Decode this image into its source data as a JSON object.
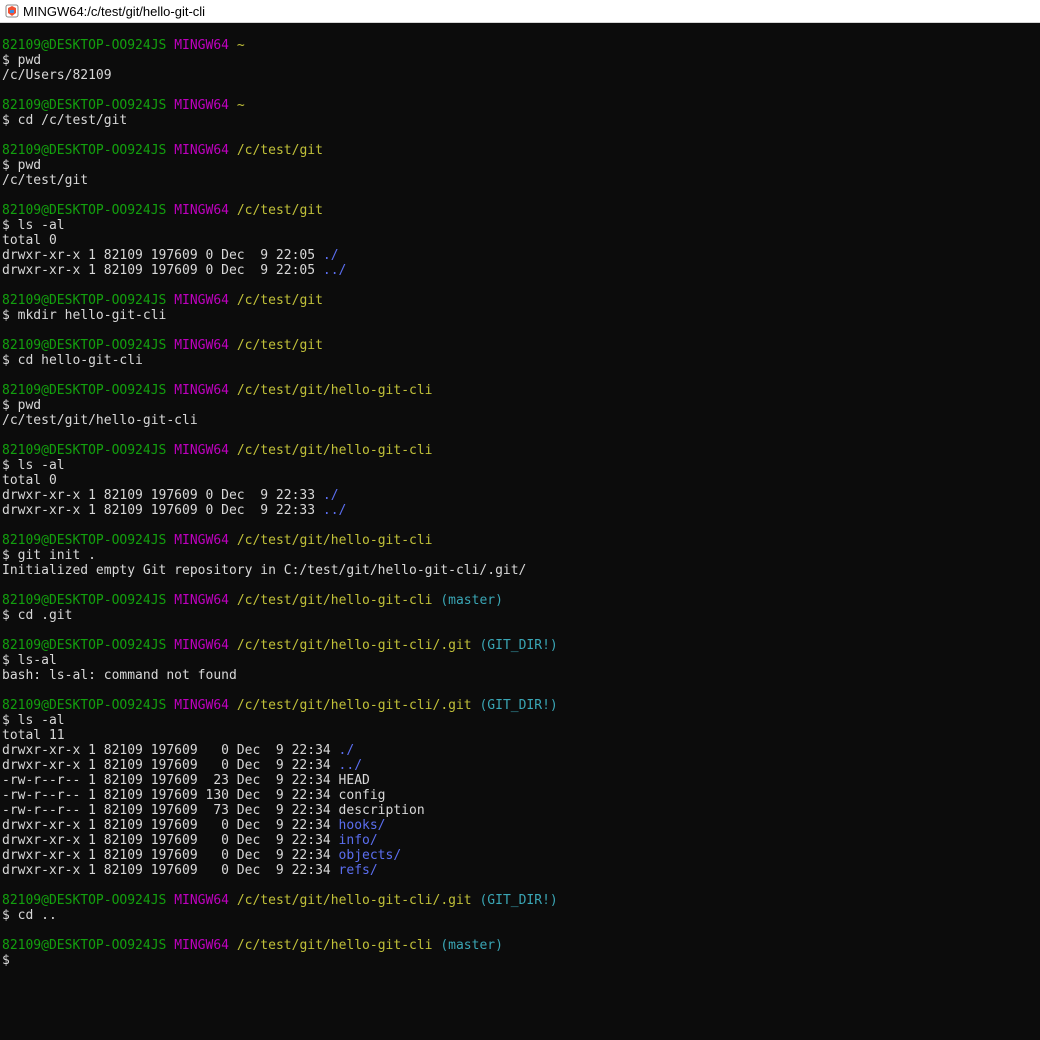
{
  "window": {
    "title": "MINGW64:/c/test/git/hello-git-cli",
    "icon": "git-bash-icon"
  },
  "colors": {
    "user": "#13a10e",
    "host": "#bf00bf",
    "path": "#c1c139",
    "branch": "#3aa6b5",
    "dir": "#5b6ef0",
    "text": "#d8d8d8",
    "background": "#0c0c0c"
  },
  "terminal": {
    "lines": [
      [
        {
          "t": "82109@DESKTOP-OO924JS",
          "c": "user"
        },
        {
          "t": " "
        },
        {
          "t": "MINGW64",
          "c": "host"
        },
        {
          "t": " "
        },
        {
          "t": "~",
          "c": "path"
        }
      ],
      [
        {
          "t": "$ pwd"
        }
      ],
      [
        {
          "t": "/c/Users/82109"
        }
      ],
      [],
      [
        {
          "t": "82109@DESKTOP-OO924JS",
          "c": "user"
        },
        {
          "t": " "
        },
        {
          "t": "MINGW64",
          "c": "host"
        },
        {
          "t": " "
        },
        {
          "t": "~",
          "c": "path"
        }
      ],
      [
        {
          "t": "$ cd /c/test/git"
        }
      ],
      [],
      [
        {
          "t": "82109@DESKTOP-OO924JS",
          "c": "user"
        },
        {
          "t": " "
        },
        {
          "t": "MINGW64",
          "c": "host"
        },
        {
          "t": " "
        },
        {
          "t": "/c/test/git",
          "c": "path"
        }
      ],
      [
        {
          "t": "$ pwd"
        }
      ],
      [
        {
          "t": "/c/test/git"
        }
      ],
      [],
      [
        {
          "t": "82109@DESKTOP-OO924JS",
          "c": "user"
        },
        {
          "t": " "
        },
        {
          "t": "MINGW64",
          "c": "host"
        },
        {
          "t": " "
        },
        {
          "t": "/c/test/git",
          "c": "path"
        }
      ],
      [
        {
          "t": "$ ls -al"
        }
      ],
      [
        {
          "t": "total 0"
        }
      ],
      [
        {
          "t": "drwxr-xr-x 1 82109 197609 0 Dec  9 22:05 "
        },
        {
          "t": "./",
          "c": "dir"
        }
      ],
      [
        {
          "t": "drwxr-xr-x 1 82109 197609 0 Dec  9 22:05 "
        },
        {
          "t": "../",
          "c": "dir"
        }
      ],
      [],
      [
        {
          "t": "82109@DESKTOP-OO924JS",
          "c": "user"
        },
        {
          "t": " "
        },
        {
          "t": "MINGW64",
          "c": "host"
        },
        {
          "t": " "
        },
        {
          "t": "/c/test/git",
          "c": "path"
        }
      ],
      [
        {
          "t": "$ mkdir hello-git-cli"
        }
      ],
      [],
      [
        {
          "t": "82109@DESKTOP-OO924JS",
          "c": "user"
        },
        {
          "t": " "
        },
        {
          "t": "MINGW64",
          "c": "host"
        },
        {
          "t": " "
        },
        {
          "t": "/c/test/git",
          "c": "path"
        }
      ],
      [
        {
          "t": "$ cd hello-git-cli"
        }
      ],
      [],
      [
        {
          "t": "82109@DESKTOP-OO924JS",
          "c": "user"
        },
        {
          "t": " "
        },
        {
          "t": "MINGW64",
          "c": "host"
        },
        {
          "t": " "
        },
        {
          "t": "/c/test/git/hello-git-cli",
          "c": "path"
        }
      ],
      [
        {
          "t": "$ pwd"
        }
      ],
      [
        {
          "t": "/c/test/git/hello-git-cli"
        }
      ],
      [],
      [
        {
          "t": "82109@DESKTOP-OO924JS",
          "c": "user"
        },
        {
          "t": " "
        },
        {
          "t": "MINGW64",
          "c": "host"
        },
        {
          "t": " "
        },
        {
          "t": "/c/test/git/hello-git-cli",
          "c": "path"
        }
      ],
      [
        {
          "t": "$ ls -al"
        }
      ],
      [
        {
          "t": "total 0"
        }
      ],
      [
        {
          "t": "drwxr-xr-x 1 82109 197609 0 Dec  9 22:33 "
        },
        {
          "t": "./",
          "c": "dir"
        }
      ],
      [
        {
          "t": "drwxr-xr-x 1 82109 197609 0 Dec  9 22:33 "
        },
        {
          "t": "../",
          "c": "dir"
        }
      ],
      [],
      [
        {
          "t": "82109@DESKTOP-OO924JS",
          "c": "user"
        },
        {
          "t": " "
        },
        {
          "t": "MINGW64",
          "c": "host"
        },
        {
          "t": " "
        },
        {
          "t": "/c/test/git/hello-git-cli",
          "c": "path"
        }
      ],
      [
        {
          "t": "$ git init ."
        }
      ],
      [
        {
          "t": "Initialized empty Git repository in C:/test/git/hello-git-cli/.git/"
        }
      ],
      [],
      [
        {
          "t": "82109@DESKTOP-OO924JS",
          "c": "user"
        },
        {
          "t": " "
        },
        {
          "t": "MINGW64",
          "c": "host"
        },
        {
          "t": " "
        },
        {
          "t": "/c/test/git/hello-git-cli",
          "c": "path"
        },
        {
          "t": " "
        },
        {
          "t": "(master)",
          "c": "branch"
        }
      ],
      [
        {
          "t": "$ cd .git"
        }
      ],
      [],
      [
        {
          "t": "82109@DESKTOP-OO924JS",
          "c": "user"
        },
        {
          "t": " "
        },
        {
          "t": "MINGW64",
          "c": "host"
        },
        {
          "t": " "
        },
        {
          "t": "/c/test/git/hello-git-cli/.git",
          "c": "path"
        },
        {
          "t": " "
        },
        {
          "t": "(GIT_DIR!)",
          "c": "branch"
        }
      ],
      [
        {
          "t": "$ ls-al"
        }
      ],
      [
        {
          "t": "bash: ls-al: command not found"
        }
      ],
      [],
      [
        {
          "t": "82109@DESKTOP-OO924JS",
          "c": "user"
        },
        {
          "t": " "
        },
        {
          "t": "MINGW64",
          "c": "host"
        },
        {
          "t": " "
        },
        {
          "t": "/c/test/git/hello-git-cli/.git",
          "c": "path"
        },
        {
          "t": " "
        },
        {
          "t": "(GIT_DIR!)",
          "c": "branch"
        }
      ],
      [
        {
          "t": "$ ls -al"
        }
      ],
      [
        {
          "t": "total 11"
        }
      ],
      [
        {
          "t": "drwxr-xr-x 1 82109 197609   0 Dec  9 22:34 "
        },
        {
          "t": "./",
          "c": "dir"
        }
      ],
      [
        {
          "t": "drwxr-xr-x 1 82109 197609   0 Dec  9 22:34 "
        },
        {
          "t": "../",
          "c": "dir"
        }
      ],
      [
        {
          "t": "-rw-r--r-- 1 82109 197609  23 Dec  9 22:34 HEAD"
        }
      ],
      [
        {
          "t": "-rw-r--r-- 1 82109 197609 130 Dec  9 22:34 config"
        }
      ],
      [
        {
          "t": "-rw-r--r-- 1 82109 197609  73 Dec  9 22:34 description"
        }
      ],
      [
        {
          "t": "drwxr-xr-x 1 82109 197609   0 Dec  9 22:34 "
        },
        {
          "t": "hooks/",
          "c": "dir"
        }
      ],
      [
        {
          "t": "drwxr-xr-x 1 82109 197609   0 Dec  9 22:34 "
        },
        {
          "t": "info/",
          "c": "dir"
        }
      ],
      [
        {
          "t": "drwxr-xr-x 1 82109 197609   0 Dec  9 22:34 "
        },
        {
          "t": "objects/",
          "c": "dir"
        }
      ],
      [
        {
          "t": "drwxr-xr-x 1 82109 197609   0 Dec  9 22:34 "
        },
        {
          "t": "refs/",
          "c": "dir"
        }
      ],
      [],
      [
        {
          "t": "82109@DESKTOP-OO924JS",
          "c": "user"
        },
        {
          "t": " "
        },
        {
          "t": "MINGW64",
          "c": "host"
        },
        {
          "t": " "
        },
        {
          "t": "/c/test/git/hello-git-cli/.git",
          "c": "path"
        },
        {
          "t": " "
        },
        {
          "t": "(GIT_DIR!)",
          "c": "branch"
        }
      ],
      [
        {
          "t": "$ cd .."
        }
      ],
      [],
      [
        {
          "t": "82109@DESKTOP-OO924JS",
          "c": "user"
        },
        {
          "t": " "
        },
        {
          "t": "MINGW64",
          "c": "host"
        },
        {
          "t": " "
        },
        {
          "t": "/c/test/git/hello-git-cli",
          "c": "path"
        },
        {
          "t": " "
        },
        {
          "t": "(master)",
          "c": "branch"
        }
      ],
      [
        {
          "t": "$"
        }
      ]
    ]
  }
}
